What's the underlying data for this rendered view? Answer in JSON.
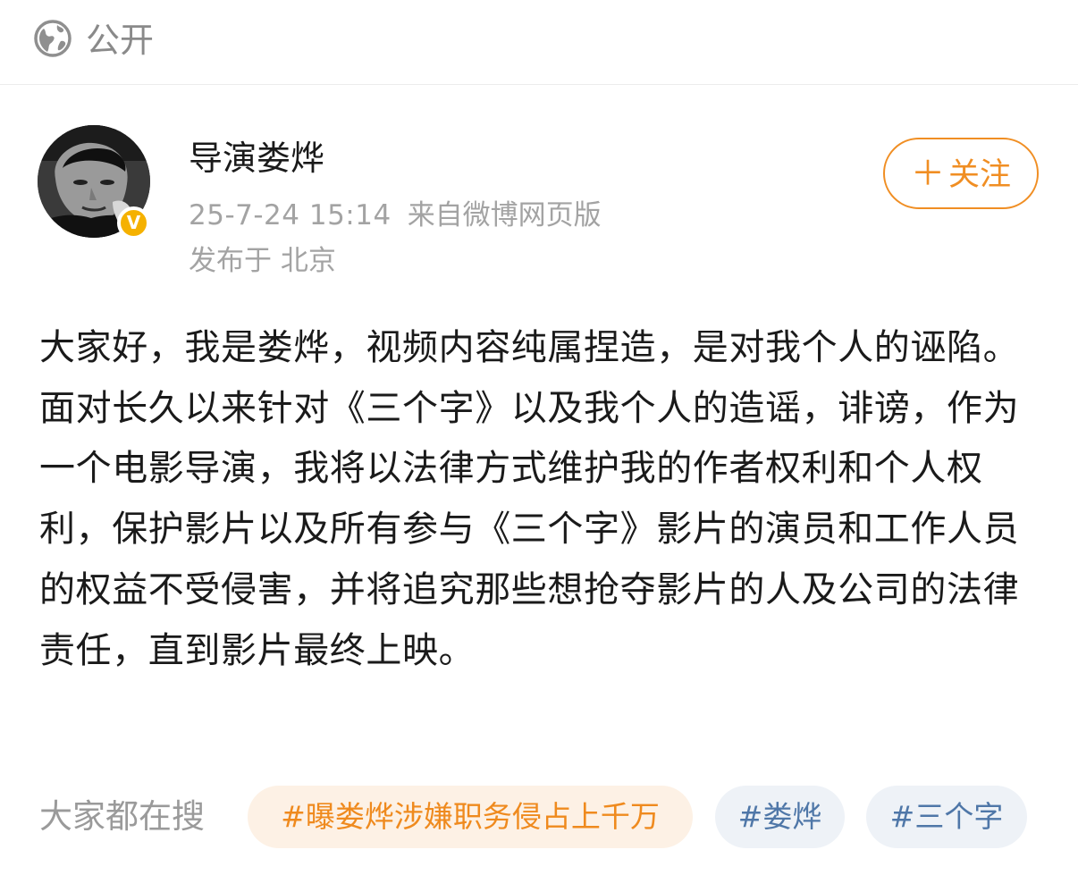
{
  "visibility": {
    "icon": "globe-icon",
    "label": "公开"
  },
  "author": {
    "name": "导演娄烨",
    "verified_badge": "V",
    "follow_label": "关注",
    "follow_icon": "plus-icon"
  },
  "post": {
    "time": "25-7-24 15:14",
    "source": "来自微博网页版",
    "location": "发布于 北京",
    "body": "大家好，我是娄烨，视频内容纯属捏造，是对我个人的诬陷。面对长久以来针对《三个字》以及我个人的造谣，诽谤，作为一个电影导演，我将以法律方式维护我的作者权利和个人权利，保护影片以及所有参与《三个字》影片的演员和工作人员的权益不受侵害，并将追究那些想抢夺影片的人及公司的法律责任，直到影片最终上映。"
  },
  "hot_search": {
    "label": "大家都在搜",
    "topics": [
      "#曝娄烨涉嫌职务侵占上千万",
      "#娄烨",
      "#三个字"
    ]
  },
  "colors": {
    "accent_orange": "#f08e23",
    "verified_yellow": "#f5b100",
    "topic_blue": "#4f77a8",
    "meta_gray": "#a3a3a3"
  }
}
